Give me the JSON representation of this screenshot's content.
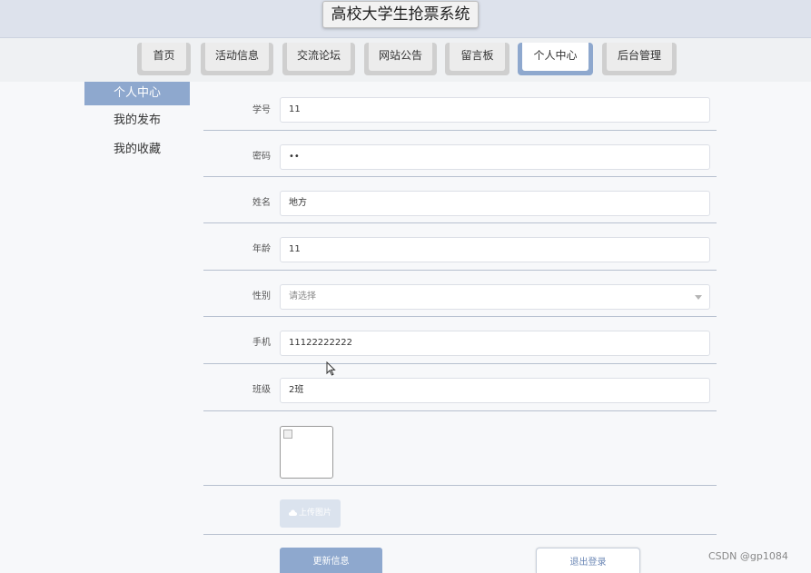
{
  "header": {
    "title": "高校大学生抢票系统"
  },
  "nav": {
    "tabs": [
      {
        "label": "首页"
      },
      {
        "label": "活动信息"
      },
      {
        "label": "交流论坛"
      },
      {
        "label": "网站公告"
      },
      {
        "label": "留言板"
      },
      {
        "label": "个人中心",
        "active": true
      },
      {
        "label": "后台管理"
      }
    ]
  },
  "sidebar": {
    "items": [
      {
        "label": "个人中心",
        "active": true
      },
      {
        "label": "我的发布"
      },
      {
        "label": "我的收藏"
      }
    ]
  },
  "form": {
    "student_id": {
      "label": "学号",
      "value": "11"
    },
    "password": {
      "label": "密码",
      "value": "••"
    },
    "name": {
      "label": "姓名",
      "value": "地方"
    },
    "age": {
      "label": "年龄",
      "value": "11"
    },
    "gender": {
      "label": "性别",
      "placeholder": "请选择"
    },
    "phone": {
      "label": "手机",
      "value": "11122222222"
    },
    "class": {
      "label": "班级",
      "value": "2班"
    },
    "upload_label": "上传图片"
  },
  "actions": {
    "update_label": "更新信息",
    "logout_label": "退出登录"
  },
  "watermark": "CSDN @gp1084",
  "colors": {
    "accent": "#8ea8ce",
    "header_bg": "#dde2ec",
    "nav_bg": "#eff1f3",
    "logout_text": "#6d88b6"
  }
}
